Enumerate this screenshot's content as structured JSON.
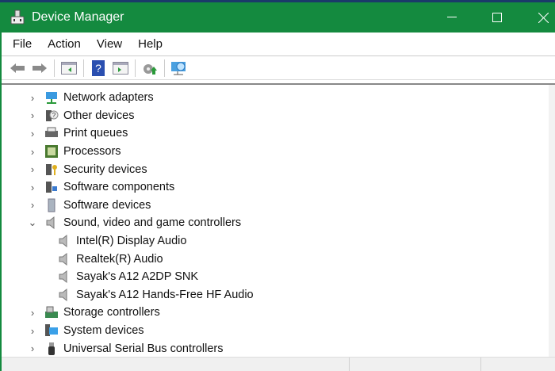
{
  "window": {
    "title": "Device Manager",
    "accent": "#148a3f"
  },
  "menu": [
    "File",
    "Action",
    "View",
    "Help"
  ],
  "tree": [
    {
      "label": "Network adapters",
      "icon": "network-adapter-icon",
      "state": "collapsed"
    },
    {
      "label": "Other devices",
      "icon": "unknown-device-icon",
      "state": "collapsed"
    },
    {
      "label": "Print queues",
      "icon": "printer-icon",
      "state": "collapsed"
    },
    {
      "label": "Processors",
      "icon": "processor-icon",
      "state": "collapsed"
    },
    {
      "label": "Security devices",
      "icon": "security-key-icon",
      "state": "collapsed"
    },
    {
      "label": "Software components",
      "icon": "software-component-icon",
      "state": "collapsed"
    },
    {
      "label": "Software devices",
      "icon": "software-device-icon",
      "state": "collapsed"
    },
    {
      "label": "Sound, video and game controllers",
      "icon": "speaker-icon",
      "state": "expanded"
    },
    {
      "label": "Intel(R) Display Audio",
      "icon": "speaker-icon",
      "child": true
    },
    {
      "label": "Realtek(R) Audio",
      "icon": "speaker-icon",
      "child": true
    },
    {
      "label": "Sayak's A12 A2DP SNK",
      "icon": "speaker-icon",
      "child": true
    },
    {
      "label": "Sayak's A12 Hands-Free HF Audio",
      "icon": "speaker-icon",
      "child": true
    },
    {
      "label": "Storage controllers",
      "icon": "storage-controller-icon",
      "state": "collapsed"
    },
    {
      "label": "System devices",
      "icon": "system-device-icon",
      "state": "collapsed"
    },
    {
      "label": "Universal Serial Bus controllers",
      "icon": "usb-icon",
      "state": "collapsed"
    }
  ]
}
